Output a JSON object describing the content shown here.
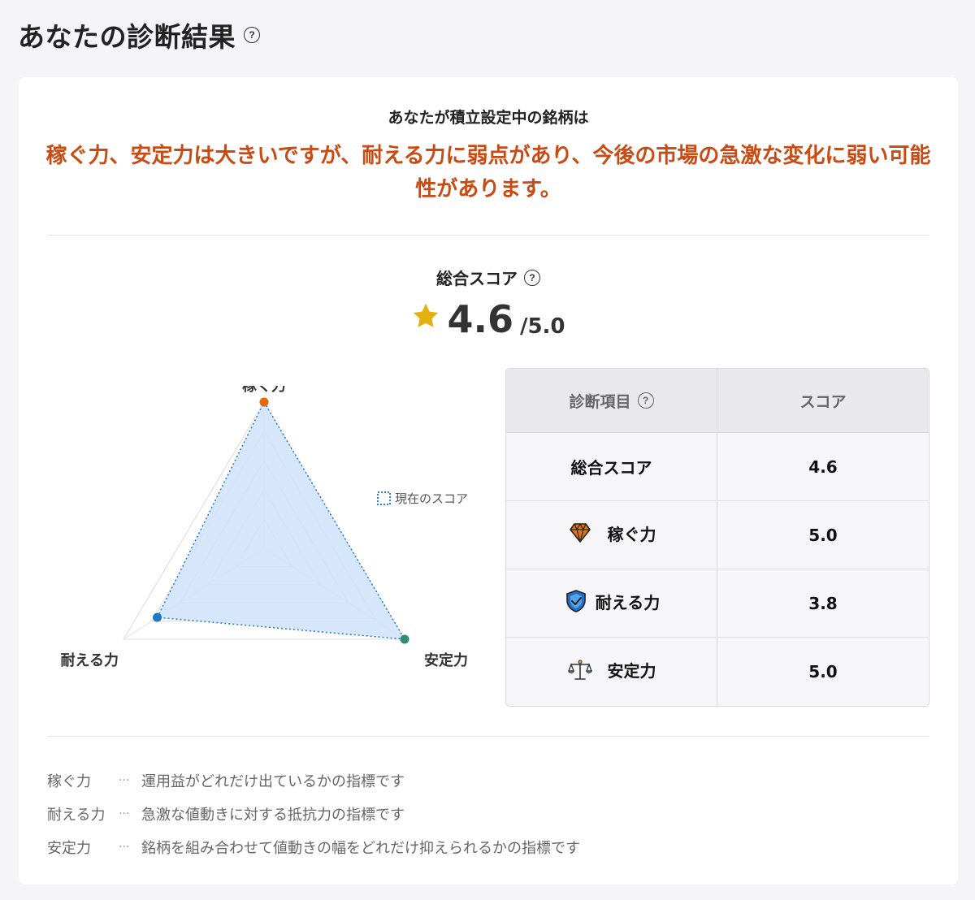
{
  "page": {
    "title": "あなたの診断結果",
    "help_icon": "question-circle-icon"
  },
  "summary": {
    "lead": "あなたが積立設定中の銘柄は",
    "message": "稼ぐ力、安定力は大きいですが、耐える力に弱点があり、今後の市場の急激な変化に弱い可能性があります。",
    "message_color": "#c94a13"
  },
  "overall": {
    "label": "総合スコア",
    "value": "4.6",
    "max": "/5.0",
    "icon": "star-icon",
    "star_color": "#e4b20f"
  },
  "radar": {
    "axes": [
      "稼ぐ力",
      "安定力",
      "耐える力"
    ],
    "legend": "現在のスコア",
    "fill_color": "#cfe3fb",
    "stroke_color": "#2f7fd1"
  },
  "chart_data": {
    "type": "radar",
    "categories": [
      "稼ぐ力",
      "安定力",
      "耐える力"
    ],
    "series": [
      {
        "name": "現在のスコア",
        "values": [
          5.0,
          5.0,
          3.8
        ]
      }
    ],
    "range": [
      0,
      5
    ],
    "point_colors": [
      "#e06a0c",
      "#2f8b73",
      "#1f78c8"
    ]
  },
  "table": {
    "headers": {
      "item": "診断項目",
      "score": "スコア"
    },
    "rows": [
      {
        "label": "総合スコア",
        "value": "4.6",
        "icon": ""
      },
      {
        "label": "稼ぐ力",
        "value": "5.0",
        "icon": "diamond-icon"
      },
      {
        "label": "耐える力",
        "value": "3.8",
        "icon": "shield-check-icon"
      },
      {
        "label": "安定力",
        "value": "5.0",
        "icon": "balance-scale-icon"
      }
    ]
  },
  "notes": [
    {
      "term": "稼ぐ力",
      "sep": "···",
      "desc": "運用益がどれだけ出ているかの指標です"
    },
    {
      "term": "耐える力",
      "sep": "···",
      "desc": "急激な値動きに対する抵抗力の指標です"
    },
    {
      "term": "安定力",
      "sep": "···",
      "desc": "銘柄を組み合わせて値動きの幅をどれだけ抑えられるかの指標です"
    }
  ]
}
